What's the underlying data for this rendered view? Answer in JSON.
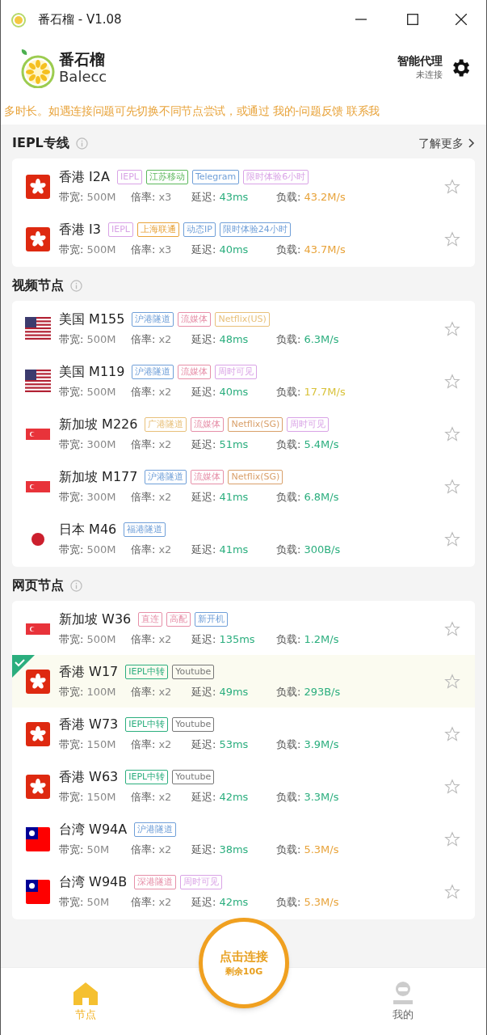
{
  "window": {
    "title": "番石榴 - V1.08"
  },
  "header": {
    "brand": "番石榴",
    "brand_sub": "Balecc",
    "mode": "智能代理",
    "status": "未连接"
  },
  "notice": "多时长。如遇连接问题可先切换不同节点尝试，或通过 我的-问题反馈 联系我",
  "sections": [
    {
      "title": "IEPL专线",
      "more": "了解更多",
      "nodes": [
        {
          "kind": "hk",
          "name": "香港 I2A",
          "tags": [
            {
              "text": "IEPL",
              "color": "#d9a3e6"
            },
            {
              "text": "江苏移动",
              "color": "#5cb85c"
            },
            {
              "text": "Telegram",
              "color": "#6f9fd8"
            },
            {
              "text": "限时体验6小时",
              "color": "#d9a3e6"
            }
          ],
          "stats": [
            {
              "label": "带宽:",
              "value": "500M"
            },
            {
              "label": "倍率:",
              "value": "x3"
            },
            {
              "label": "延迟:",
              "value": "43ms"
            },
            {
              "label": "负载:",
              "value": "43.2M/s",
              "color": "#e8a33a"
            }
          ],
          "selected": false,
          "favorite": false
        },
        {
          "kind": "hk",
          "name": "香港 I3",
          "tags": [
            {
              "text": "IEPL",
              "color": "#d9a3e6"
            },
            {
              "text": "上海联通",
              "color": "#e8a33a"
            },
            {
              "text": "动态IP",
              "color": "#6f9fd8"
            },
            {
              "text": "限时体验24小时",
              "color": "#6f9fd8"
            }
          ],
          "stats": [
            {
              "label": "带宽:",
              "value": "500M"
            },
            {
              "label": "倍率:",
              "value": "x3"
            },
            {
              "label": "延迟:",
              "value": "40ms"
            },
            {
              "label": "负载:",
              "value": "43.7M/s",
              "color": "#e8a33a"
            }
          ],
          "selected": false,
          "favorite": false
        }
      ]
    },
    {
      "title": "视频节点",
      "nodes": [
        {
          "kind": "us",
          "name": "美国 M155",
          "tags": [
            {
              "text": "沪港隧道",
              "color": "#6f9fd8"
            },
            {
              "text": "流媒体",
              "color": "#e68fa8"
            },
            {
              "text": "Netflix(US)",
              "color": "#e8c07a"
            }
          ],
          "stats": [
            {
              "label": "带宽:",
              "value": "500M"
            },
            {
              "label": "倍率:",
              "value": "x2"
            },
            {
              "label": "延迟:",
              "value": "48ms"
            },
            {
              "label": "负载:",
              "value": "6.3M/s",
              "color": "#2bae7e"
            }
          ],
          "selected": false,
          "favorite": false
        },
        {
          "kind": "us",
          "name": "美国 M119",
          "tags": [
            {
              "text": "沪港隧道",
              "color": "#6f9fd8"
            },
            {
              "text": "流媒体",
              "color": "#e68fa8"
            },
            {
              "text": "周时可见",
              "color": "#d9a3e6"
            }
          ],
          "stats": [
            {
              "label": "带宽:",
              "value": "500M"
            },
            {
              "label": "倍率:",
              "value": "x2"
            },
            {
              "label": "延迟:",
              "value": "40ms"
            },
            {
              "label": "负载:",
              "value": "17.7M/s",
              "color": "#d9c23a"
            }
          ],
          "selected": false,
          "favorite": false
        },
        {
          "kind": "sg",
          "name": "新加坡 M226",
          "tags": [
            {
              "text": "广港隧道",
              "color": "#e8c07a"
            },
            {
              "text": "流媒体",
              "color": "#e68fa8"
            },
            {
              "text": "Netflix(SG)",
              "color": "#d9a06a"
            },
            {
              "text": "周时可见",
              "color": "#d9a3e6"
            }
          ],
          "stats": [
            {
              "label": "带宽:",
              "value": "300M"
            },
            {
              "label": "倍率:",
              "value": "x2"
            },
            {
              "label": "延迟:",
              "value": "51ms"
            },
            {
              "label": "负载:",
              "value": "5.4M/s",
              "color": "#2bae7e"
            }
          ],
          "selected": false,
          "favorite": false
        },
        {
          "kind": "sg",
          "name": "新加坡 M177",
          "tags": [
            {
              "text": "沪港隧道",
              "color": "#6f9fd8"
            },
            {
              "text": "流媒体",
              "color": "#e68fa8"
            },
            {
              "text": "Netflix(SG)",
              "color": "#d9a06a"
            }
          ],
          "stats": [
            {
              "label": "带宽:",
              "value": "300M"
            },
            {
              "label": "倍率:",
              "value": "x2"
            },
            {
              "label": "延迟:",
              "value": "41ms"
            },
            {
              "label": "负载:",
              "value": "6.8M/s",
              "color": "#2bae7e"
            }
          ],
          "selected": false,
          "favorite": false
        },
        {
          "kind": "jp",
          "name": "日本 M46",
          "tags": [
            {
              "text": "福港隧道",
              "color": "#6f9fd8"
            }
          ],
          "stats": [
            {
              "label": "带宽:",
              "value": "500M"
            },
            {
              "label": "倍率:",
              "value": "x2"
            },
            {
              "label": "延迟:",
              "value": "41ms"
            },
            {
              "label": "负载:",
              "value": "300B/s",
              "color": "#2bae7e"
            }
          ],
          "selected": false,
          "favorite": false
        }
      ]
    },
    {
      "title": "网页节点",
      "nodes": [
        {
          "kind": "sg",
          "name": "新加坡 W36",
          "tags": [
            {
              "text": "直连",
              "color": "#e68fa8"
            },
            {
              "text": "高配",
              "color": "#e68fa8"
            },
            {
              "text": "新开机",
              "color": "#6f9fd8"
            }
          ],
          "stats": [
            {
              "label": "带宽:",
              "value": "500M"
            },
            {
              "label": "倍率:",
              "value": "x2"
            },
            {
              "label": "延迟:",
              "value": "135ms"
            },
            {
              "label": "负载:",
              "value": "1.2M/s",
              "color": "#2bae7e"
            }
          ],
          "selected": false,
          "favorite": false
        },
        {
          "kind": "hk",
          "name": "香港 W17",
          "tags": [
            {
              "text": "IEPL中转",
              "color": "#2bae7e"
            },
            {
              "text": "Youtube",
              "color": "#777777"
            }
          ],
          "stats": [
            {
              "label": "带宽:",
              "value": "100M"
            },
            {
              "label": "倍率:",
              "value": "x2"
            },
            {
              "label": "延迟:",
              "value": "49ms"
            },
            {
              "label": "负载:",
              "value": "293B/s",
              "color": "#2bae7e"
            }
          ],
          "selected": true,
          "favorite": false
        },
        {
          "kind": "hk",
          "name": "香港 W73",
          "tags": [
            {
              "text": "IEPL中转",
              "color": "#2bae7e"
            },
            {
              "text": "Youtube",
              "color": "#777777"
            }
          ],
          "stats": [
            {
              "label": "带宽:",
              "value": "150M"
            },
            {
              "label": "倍率:",
              "value": "x2"
            },
            {
              "label": "延迟:",
              "value": "53ms"
            },
            {
              "label": "负载:",
              "value": "3.9M/s",
              "color": "#2bae7e"
            }
          ],
          "selected": false,
          "favorite": false
        },
        {
          "kind": "hk",
          "name": "香港 W63",
          "tags": [
            {
              "text": "IEPL中转",
              "color": "#2bae7e"
            },
            {
              "text": "Youtube",
              "color": "#777777"
            }
          ],
          "stats": [
            {
              "label": "带宽:",
              "value": "150M"
            },
            {
              "label": "倍率:",
              "value": "x2"
            },
            {
              "label": "延迟:",
              "value": "42ms"
            },
            {
              "label": "负载:",
              "value": "3.3M/s",
              "color": "#2bae7e"
            }
          ],
          "selected": false,
          "favorite": false
        },
        {
          "kind": "tw",
          "name": "台湾 W94A",
          "tags": [
            {
              "text": "沪港隧道",
              "color": "#6f9fd8"
            }
          ],
          "stats": [
            {
              "label": "带宽:",
              "value": "50M"
            },
            {
              "label": "倍率:",
              "value": "x2"
            },
            {
              "label": "延迟:",
              "value": "38ms"
            },
            {
              "label": "负载:",
              "value": "5.3M/s",
              "color": "#e8a33a"
            }
          ],
          "selected": false,
          "favorite": false
        },
        {
          "kind": "tw",
          "name": "台湾 W94B",
          "tags": [
            {
              "text": "深港隧道",
              "color": "#e68fa8"
            },
            {
              "text": "周时可见",
              "color": "#d9a3e6"
            }
          ],
          "stats": [
            {
              "label": "带宽:",
              "value": "50M"
            },
            {
              "label": "倍率:",
              "value": "x2"
            },
            {
              "label": "延迟:",
              "value": "42ms"
            },
            {
              "label": "负载:",
              "value": "5.3M/s",
              "color": "#e8a33a"
            }
          ],
          "selected": false,
          "favorite": false
        }
      ]
    }
  ],
  "connect": {
    "label": "点击连接",
    "sub": "剩余10G"
  },
  "nav": [
    {
      "label": "节点",
      "kind": "home",
      "selected": true
    },
    {
      "label": "我的",
      "kind": "user",
      "selected": false
    }
  ]
}
